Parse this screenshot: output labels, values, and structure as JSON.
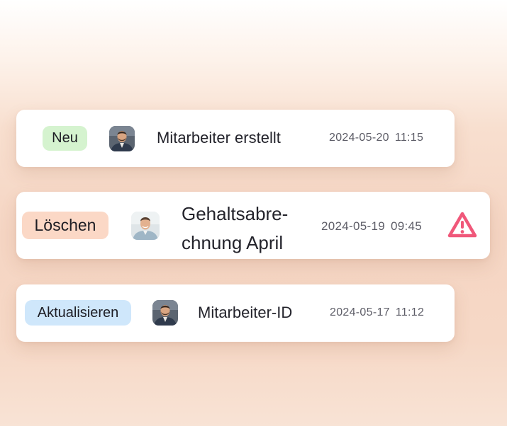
{
  "colors": {
    "badge_new_bg": "#d5f3cf",
    "badge_delete_bg": "#fbd8c6",
    "badge_update_bg": "#cfe7fb",
    "warning": "#f0587a"
  },
  "items": [
    {
      "badge": "Neu",
      "avatar_icon": "person-beard-avatar",
      "title": "Mitarbeiter erstellt",
      "date": "2024-05-20",
      "time": "11:15"
    },
    {
      "badge": "Löschen",
      "avatar_icon": "person-avatar",
      "title": "Gehaltsabre­chnung April",
      "date": "2024-05-19",
      "time": "09:45",
      "status_icon": "warning-triangle-icon"
    },
    {
      "badge": "Aktualisieren",
      "avatar_icon": "person-beard-avatar",
      "title": "Mitarbeiter-ID",
      "date": "2024-05-17",
      "time": "11:12"
    }
  ]
}
